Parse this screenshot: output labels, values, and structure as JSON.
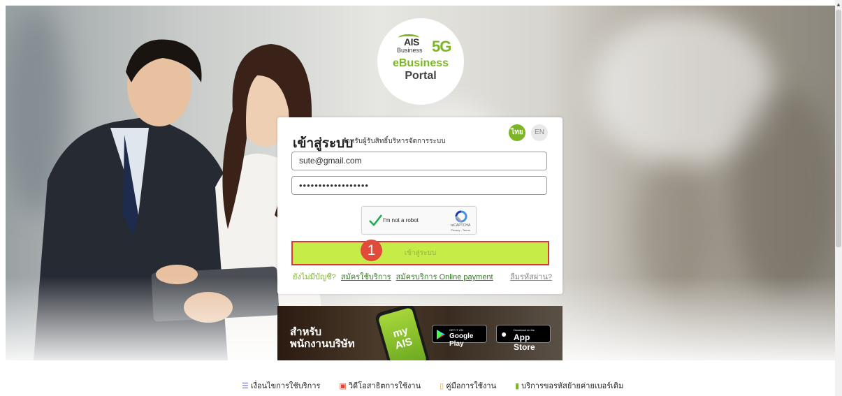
{
  "logo": {
    "ais": "AIS",
    "business": "Business",
    "five_g": "5G",
    "line1": "eBusiness",
    "line2": "Portal"
  },
  "login": {
    "title": "เข้าสู่ระบบ",
    "subtitle": "สำหรับผู้รับสิทธิ์บริหารจัดการระบบ",
    "lang_th": "ไทย",
    "lang_en": "EN",
    "email_value": "sute@gmail.com",
    "password_value": "••••••••••••••••••",
    "captcha_label": "I'm not a robot",
    "captcha_brand": "reCAPTCHA",
    "captcha_links": "Privacy - Terms",
    "submit_label": "เข้าสู่ระบบ",
    "step_badge": "1",
    "no_account": "ยังไม่มีบัญชี?",
    "register_link": "สมัครใช้บริการ",
    "register_payment_link": "สมัครบริการ Online payment",
    "forgot_link": "ลืมรหัสผ่าน?"
  },
  "promo": {
    "line1": "สำหรับ",
    "line2": "พนักงานบริษัท",
    "app_name": "my AIS",
    "google_small": "GET IT ON",
    "google_big": "Google Play",
    "apple_small": "Download on the",
    "apple_big": "App Store"
  },
  "footer": {
    "items": [
      {
        "label": "เงื่อนไขการใช้บริการ",
        "icon": "list-icon",
        "color": "#6a6fd0"
      },
      {
        "label": "วิดีโอสาธิตการใช้งาน",
        "icon": "video-icon",
        "color": "#e0452f"
      },
      {
        "label": "คู่มือการใช้งาน",
        "icon": "book-icon",
        "color": "#e8a43a"
      },
      {
        "label": "บริการขอรหัสย้ายค่ายเบอร์เดิม",
        "icon": "phone-icon",
        "color": "#7cb526"
      }
    ]
  },
  "colors": {
    "accent_green": "#7cb526",
    "button_fill": "#c6ec47",
    "highlight_red": "#d93a2f"
  }
}
